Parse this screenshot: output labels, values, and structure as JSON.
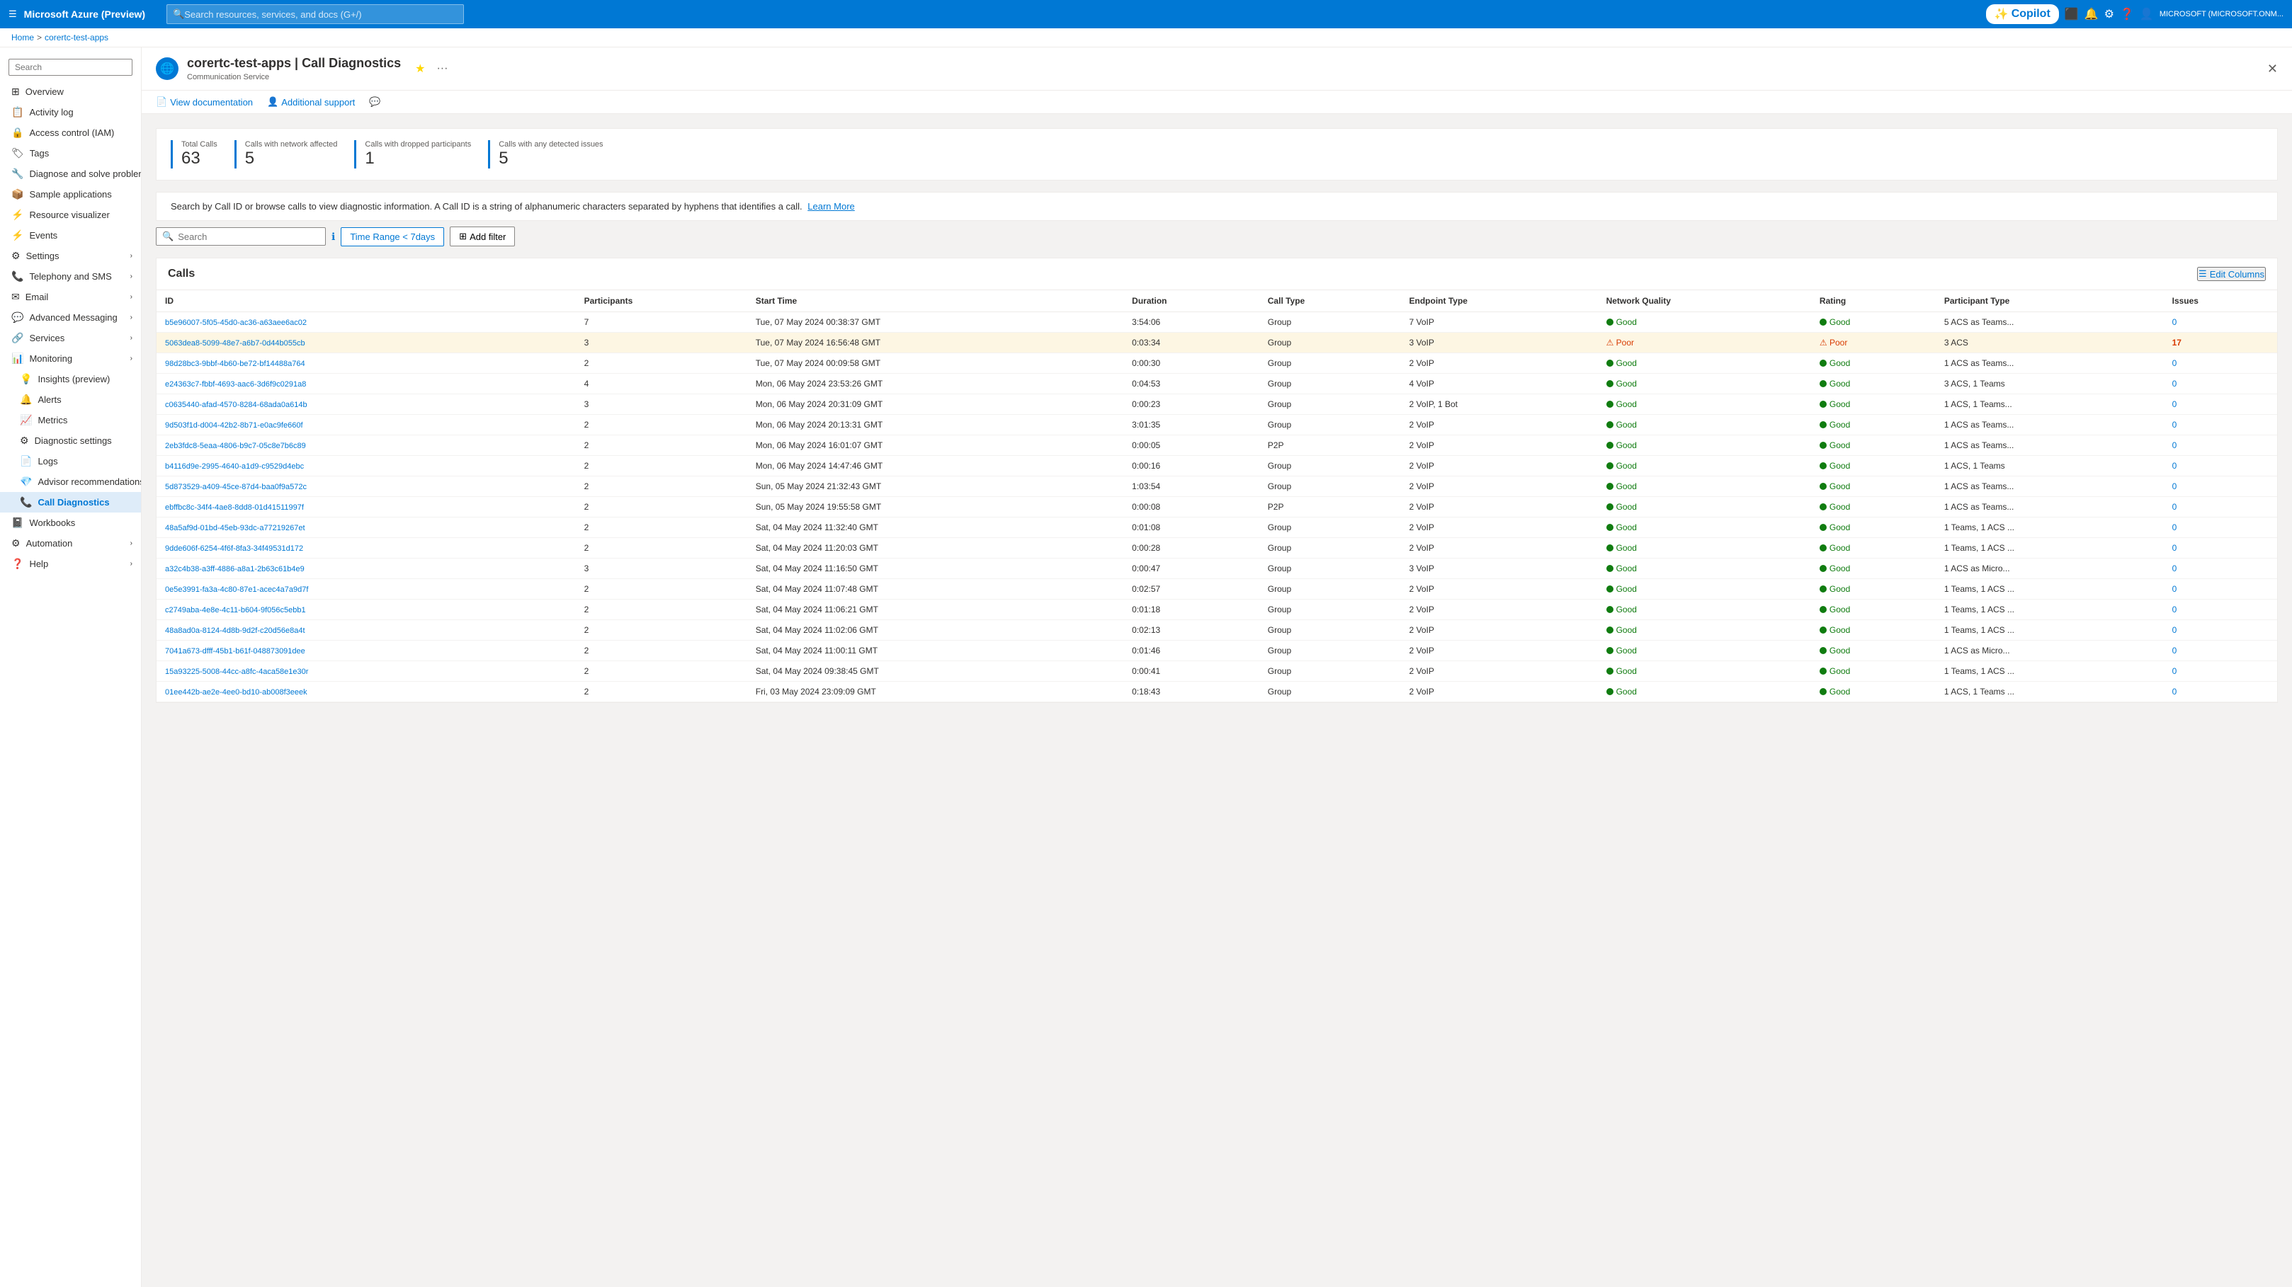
{
  "topNav": {
    "hamburger": "☰",
    "brand": "Microsoft Azure (Preview)",
    "searchPlaceholder": "Search resources, services, and docs (G+/)",
    "copilotLabel": "Copilot",
    "userInfo": "MICROSOFT (MICROSOFT.ONM..."
  },
  "breadcrumb": {
    "home": "Home",
    "separator": ">",
    "resource": "corertc-test-apps"
  },
  "pageHeader": {
    "title": "corertc-test-apps | Call Diagnostics",
    "subtitle": "Communication Service",
    "starIcon": "★",
    "moreIcon": "···"
  },
  "actionBar": [
    {
      "icon": "📄",
      "label": "View documentation"
    },
    {
      "icon": "👤",
      "label": "Additional support"
    },
    {
      "icon": "💬",
      "label": ""
    }
  ],
  "stats": [
    {
      "label": "Total Calls",
      "value": "63"
    },
    {
      "label": "Calls with network affected",
      "value": "5"
    },
    {
      "label": "Calls with dropped participants",
      "value": "1"
    },
    {
      "label": "Calls with any detected issues",
      "value": "5"
    }
  ],
  "descriptionText": "Search by Call ID or browse calls to view diagnostic information. A Call ID is a string of alphanumeric characters separated by hyphens that identifies a call.",
  "learnMoreLabel": "Learn More",
  "searchPlaceholder": "Search",
  "timeRangeLabel": "Time Range < 7days",
  "addFilterLabel": "Add filter",
  "infoIcon": "ℹ",
  "callsTitle": "Calls",
  "editColumnsLabel": "Edit Columns",
  "tableHeaders": [
    "ID",
    "Participants",
    "Start Time",
    "Duration",
    "Call Type",
    "Endpoint Type",
    "Network Quality",
    "Rating",
    "Participant Type",
    "Issues"
  ],
  "calls": [
    {
      "id": "b5e96007-5f05-45d0-ac36-a63aee6ac02",
      "participants": "7",
      "startTime": "Tue, 07 May 2024 00:38:37 GMT",
      "duration": "3:54:06",
      "callType": "Group",
      "endpointType": "7 VoIP",
      "networkQuality": "Good",
      "rating": "Good",
      "participantType": "5 ACS as Teams...",
      "issues": "0",
      "highlighted": false
    },
    {
      "id": "5063dea8-5099-48e7-a6b7-0d44b055cb",
      "participants": "3",
      "startTime": "Tue, 07 May 2024 16:56:48 GMT",
      "duration": "0:03:34",
      "callType": "Group",
      "endpointType": "3 VoIP",
      "networkQuality": "Poor",
      "rating": "Poor",
      "participantType": "3 ACS",
      "issues": "17",
      "highlighted": true
    },
    {
      "id": "98d28bc3-9bbf-4b60-be72-bf14488a764",
      "participants": "2",
      "startTime": "Tue, 07 May 2024 00:09:58 GMT",
      "duration": "0:00:30",
      "callType": "Group",
      "endpointType": "2 VoIP",
      "networkQuality": "Good",
      "rating": "Good",
      "participantType": "1 ACS as Teams...",
      "issues": "0",
      "highlighted": false
    },
    {
      "id": "e24363c7-fbbf-4693-aac6-3d6f9c0291a8",
      "participants": "4",
      "startTime": "Mon, 06 May 2024 23:53:26 GMT",
      "duration": "0:04:53",
      "callType": "Group",
      "endpointType": "4 VoIP",
      "networkQuality": "Good",
      "rating": "Good",
      "participantType": "3 ACS, 1 Teams",
      "issues": "0",
      "highlighted": false
    },
    {
      "id": "c0635440-afad-4570-8284-68ada0a614b",
      "participants": "3",
      "startTime": "Mon, 06 May 2024 20:31:09 GMT",
      "duration": "0:00:23",
      "callType": "Group",
      "endpointType": "2 VoIP, 1 Bot",
      "networkQuality": "Good",
      "rating": "Good",
      "participantType": "1 ACS, 1 Teams...",
      "issues": "0",
      "highlighted": false
    },
    {
      "id": "9d503f1d-d004-42b2-8b71-e0ac9fe660f",
      "participants": "2",
      "startTime": "Mon, 06 May 2024 20:13:31 GMT",
      "duration": "3:01:35",
      "callType": "Group",
      "endpointType": "2 VoIP",
      "networkQuality": "Good",
      "rating": "Good",
      "participantType": "1 ACS as Teams...",
      "issues": "0",
      "highlighted": false
    },
    {
      "id": "2eb3fdc8-5eaa-4806-b9c7-05c8e7b6c89",
      "participants": "2",
      "startTime": "Mon, 06 May 2024 16:01:07 GMT",
      "duration": "0:00:05",
      "callType": "P2P",
      "endpointType": "2 VoIP",
      "networkQuality": "Good",
      "rating": "Good",
      "participantType": "1 ACS as Teams...",
      "issues": "0",
      "highlighted": false
    },
    {
      "id": "b4116d9e-2995-4640-a1d9-c9529d4ebc",
      "participants": "2",
      "startTime": "Mon, 06 May 2024 14:47:46 GMT",
      "duration": "0:00:16",
      "callType": "Group",
      "endpointType": "2 VoIP",
      "networkQuality": "Good",
      "rating": "Good",
      "participantType": "1 ACS, 1 Teams",
      "issues": "0",
      "highlighted": false
    },
    {
      "id": "5d873529-a409-45ce-87d4-baa0f9a572c",
      "participants": "2",
      "startTime": "Sun, 05 May 2024 21:32:43 GMT",
      "duration": "1:03:54",
      "callType": "Group",
      "endpointType": "2 VoIP",
      "networkQuality": "Good",
      "rating": "Good",
      "participantType": "1 ACS as Teams...",
      "issues": "0",
      "highlighted": false
    },
    {
      "id": "ebffbc8c-34f4-4ae8-8dd8-01d41511997f",
      "participants": "2",
      "startTime": "Sun, 05 May 2024 19:55:58 GMT",
      "duration": "0:00:08",
      "callType": "P2P",
      "endpointType": "2 VoIP",
      "networkQuality": "Good",
      "rating": "Good",
      "participantType": "1 ACS as Teams...",
      "issues": "0",
      "highlighted": false
    },
    {
      "id": "48a5af9d-01bd-45eb-93dc-a77219267et",
      "participants": "2",
      "startTime": "Sat, 04 May 2024 11:32:40 GMT",
      "duration": "0:01:08",
      "callType": "Group",
      "endpointType": "2 VoIP",
      "networkQuality": "Good",
      "rating": "Good",
      "participantType": "1 Teams, 1 ACS ...",
      "issues": "0",
      "highlighted": false
    },
    {
      "id": "9dde606f-6254-4f6f-8fa3-34f49531d172",
      "participants": "2",
      "startTime": "Sat, 04 May 2024 11:20:03 GMT",
      "duration": "0:00:28",
      "callType": "Group",
      "endpointType": "2 VoIP",
      "networkQuality": "Good",
      "rating": "Good",
      "participantType": "1 Teams, 1 ACS ...",
      "issues": "0",
      "highlighted": false
    },
    {
      "id": "a32c4b38-a3ff-4886-a8a1-2b63c61b4e9",
      "participants": "3",
      "startTime": "Sat, 04 May 2024 11:16:50 GMT",
      "duration": "0:00:47",
      "callType": "Group",
      "endpointType": "3 VoIP",
      "networkQuality": "Good",
      "rating": "Good",
      "participantType": "1 ACS as Micro...",
      "issues": "0",
      "highlighted": false
    },
    {
      "id": "0e5e3991-fa3a-4c80-87e1-acec4a7a9d7f",
      "participants": "2",
      "startTime": "Sat, 04 May 2024 11:07:48 GMT",
      "duration": "0:02:57",
      "callType": "Group",
      "endpointType": "2 VoIP",
      "networkQuality": "Good",
      "rating": "Good",
      "participantType": "1 Teams, 1 ACS ...",
      "issues": "0",
      "highlighted": false
    },
    {
      "id": "c2749aba-4e8e-4c11-b604-9f056c5ebb1",
      "participants": "2",
      "startTime": "Sat, 04 May 2024 11:06:21 GMT",
      "duration": "0:01:18",
      "callType": "Group",
      "endpointType": "2 VoIP",
      "networkQuality": "Good",
      "rating": "Good",
      "participantType": "1 Teams, 1 ACS ...",
      "issues": "0",
      "highlighted": false
    },
    {
      "id": "48a8ad0a-8124-4d8b-9d2f-c20d56e8a4t",
      "participants": "2",
      "startTime": "Sat, 04 May 2024 11:02:06 GMT",
      "duration": "0:02:13",
      "callType": "Group",
      "endpointType": "2 VoIP",
      "networkQuality": "Good",
      "rating": "Good",
      "participantType": "1 Teams, 1 ACS ...",
      "issues": "0",
      "highlighted": false
    },
    {
      "id": "7041a673-dfff-45b1-b61f-048873091dee",
      "participants": "2",
      "startTime": "Sat, 04 May 2024 11:00:11 GMT",
      "duration": "0:01:46",
      "callType": "Group",
      "endpointType": "2 VoIP",
      "networkQuality": "Good",
      "rating": "Good",
      "participantType": "1 ACS as Micro...",
      "issues": "0",
      "highlighted": false
    },
    {
      "id": "15a93225-5008-44cc-a8fc-4aca58e1e30r",
      "participants": "2",
      "startTime": "Sat, 04 May 2024 09:38:45 GMT",
      "duration": "0:00:41",
      "callType": "Group",
      "endpointType": "2 VoIP",
      "networkQuality": "Good",
      "rating": "Good",
      "participantType": "1 Teams, 1 ACS ...",
      "issues": "0",
      "highlighted": false
    },
    {
      "id": "01ee442b-ae2e-4ee0-bd10-ab008f3eeek",
      "participants": "2",
      "startTime": "Fri, 03 May 2024 23:09:09 GMT",
      "duration": "0:18:43",
      "callType": "Group",
      "endpointType": "2 VoIP",
      "networkQuality": "Good",
      "rating": "Good",
      "participantType": "1 ACS, 1 Teams ...",
      "issues": "0",
      "highlighted": false
    }
  ],
  "sidebar": {
    "searchPlaceholder": "Search",
    "items": [
      {
        "id": "overview",
        "label": "Overview",
        "icon": "⊞",
        "active": false
      },
      {
        "id": "activity-log",
        "label": "Activity log",
        "icon": "📋",
        "active": false
      },
      {
        "id": "access-control",
        "label": "Access control (IAM)",
        "icon": "🔒",
        "active": false
      },
      {
        "id": "tags",
        "label": "Tags",
        "icon": "🏷",
        "active": false
      },
      {
        "id": "diagnose",
        "label": "Diagnose and solve problems",
        "icon": "🔧",
        "active": false
      },
      {
        "id": "sample-apps",
        "label": "Sample applications",
        "icon": "📦",
        "active": false
      },
      {
        "id": "resource-visualizer",
        "label": "Resource visualizer",
        "icon": "⚡",
        "active": false
      },
      {
        "id": "events",
        "label": "Events",
        "icon": "⚡",
        "active": false
      },
      {
        "id": "settings",
        "label": "Settings",
        "icon": "⚙",
        "active": false,
        "expandable": true
      },
      {
        "id": "telephony-sms",
        "label": "Telephony and SMS",
        "icon": "📞",
        "active": false,
        "expandable": true
      },
      {
        "id": "email",
        "label": "Email",
        "icon": "✉",
        "active": false,
        "expandable": true
      },
      {
        "id": "advanced-messaging",
        "label": "Advanced Messaging",
        "icon": "💬",
        "active": false,
        "expandable": true
      },
      {
        "id": "services",
        "label": "Services",
        "icon": "🔗",
        "active": false,
        "expandable": true
      },
      {
        "id": "monitoring",
        "label": "Monitoring",
        "icon": "📊",
        "active": false,
        "expandable": true,
        "expanded": true
      },
      {
        "id": "insights",
        "label": "Insights (preview)",
        "icon": "💡",
        "active": false,
        "sub": true
      },
      {
        "id": "alerts",
        "label": "Alerts",
        "icon": "🔔",
        "active": false,
        "sub": true
      },
      {
        "id": "metrics",
        "label": "Metrics",
        "icon": "📈",
        "active": false,
        "sub": true
      },
      {
        "id": "diagnostic-settings",
        "label": "Diagnostic settings",
        "icon": "⚙",
        "active": false,
        "sub": true
      },
      {
        "id": "logs",
        "label": "Logs",
        "icon": "📄",
        "active": false,
        "sub": true
      },
      {
        "id": "advisor-recommendations",
        "label": "Advisor recommendations",
        "icon": "💎",
        "active": false,
        "sub": true
      },
      {
        "id": "call-diagnostics",
        "label": "Call Diagnostics",
        "icon": "📞",
        "active": true,
        "sub": true
      },
      {
        "id": "workbooks",
        "label": "Workbooks",
        "icon": "📓",
        "active": false
      },
      {
        "id": "automation",
        "label": "Automation",
        "icon": "⚙",
        "active": false,
        "expandable": true
      },
      {
        "id": "help",
        "label": "Help",
        "icon": "❓",
        "active": false,
        "expandable": true
      }
    ]
  }
}
